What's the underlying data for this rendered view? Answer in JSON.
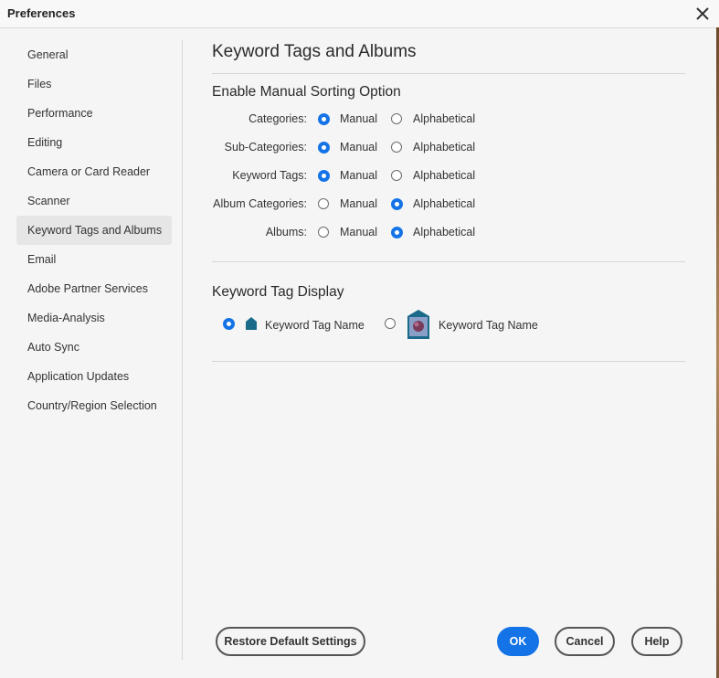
{
  "window": {
    "title": "Preferences",
    "close_icon": "close-icon"
  },
  "sidebar": {
    "items": [
      {
        "label": "General"
      },
      {
        "label": "Files"
      },
      {
        "label": "Performance"
      },
      {
        "label": "Editing"
      },
      {
        "label": "Camera or Card Reader"
      },
      {
        "label": "Scanner"
      },
      {
        "label": "Keyword Tags and Albums",
        "active": true
      },
      {
        "label": "Email"
      },
      {
        "label": "Adobe Partner Services"
      },
      {
        "label": "Media-Analysis"
      },
      {
        "label": "Auto Sync"
      },
      {
        "label": "Application Updates"
      },
      {
        "label": "Country/Region Selection"
      }
    ]
  },
  "main": {
    "title": "Keyword Tags and Albums",
    "sorting": {
      "heading": "Enable Manual Sorting Option",
      "option_manual": "Manual",
      "option_alpha": "Alphabetical",
      "rows": [
        {
          "label": "Categories:",
          "selected": "Manual"
        },
        {
          "label": "Sub-Categories:",
          "selected": "Manual"
        },
        {
          "label": "Keyword Tags:",
          "selected": "Manual"
        },
        {
          "label": "Album Categories:",
          "selected": "Alphabetical"
        },
        {
          "label": "Albums:",
          "selected": "Alphabetical"
        }
      ]
    },
    "display": {
      "heading": "Keyword Tag Display",
      "option_small_label": "Keyword Tag Name",
      "option_large_label": "Keyword Tag Name",
      "selected": "small",
      "small_icon": "tag-icon",
      "large_icon": "tag-thumbnail-icon"
    }
  },
  "footer": {
    "restore_label": "Restore Default Settings",
    "ok_label": "OK",
    "cancel_label": "Cancel",
    "help_label": "Help"
  },
  "colors": {
    "accent": "#1473e6",
    "tag_icon": "#1a6a8a"
  }
}
